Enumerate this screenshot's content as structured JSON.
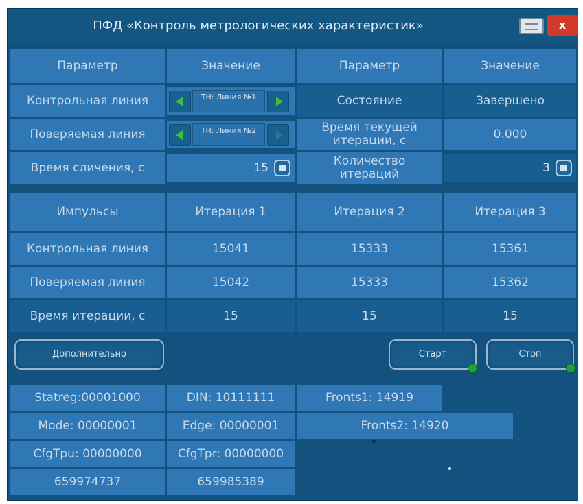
{
  "window": {
    "title": "ПФД «Контроль метрологических характеристик»",
    "close_label": "x"
  },
  "params": {
    "header_param": "Параметр",
    "header_value": "Значение",
    "control_line_label": "Контрольная линия",
    "control_line_value": "ТН: Линия №1",
    "tested_line_label": "Поверяемая линия",
    "tested_line_value": "ТН: Линия №2",
    "compare_time_label": "Время сличения, с",
    "compare_time_value": "15",
    "state_label": "Состояние",
    "state_value": "Завершено",
    "iter_time_label": "Время текущей итерации, с",
    "iter_time_value": "0.000",
    "iter_count_label": "Количество итераций",
    "iter_count_value": "3"
  },
  "pulses": {
    "headers": [
      "Импульсы",
      "Итерация 1",
      "Итерация 2",
      "Итерация 3"
    ],
    "rows": [
      {
        "label": "Контрольная линия",
        "values": [
          "15041",
          "15333",
          "15361"
        ]
      },
      {
        "label": "Поверяемая линия",
        "values": [
          "15042",
          "15333",
          "15362"
        ]
      },
      {
        "label": "Время итерации, с",
        "values": [
          "15",
          "15",
          "15"
        ]
      }
    ]
  },
  "buttons": {
    "more": "Дополнительно",
    "start": "Старт",
    "stop": "Стоп"
  },
  "debug": {
    "statreg": "Statreg:00001000",
    "din": "DIN:   10111111",
    "fronts1": "Fronts1: 14919",
    "mode": "Mode:  00000001",
    "edge": "Edge:  00000001",
    "fronts2": "Fronts2: 14920",
    "cfgtpu": "CfgTpu:  00000000",
    "cfgtpr": "CfgTpr:  00000000",
    "counter1": "659974737",
    "counter2": "659985389"
  },
  "colors": {
    "window_bg": "#13527f",
    "cell": "#2f78b5",
    "cell_dark": "#185e90",
    "text": "#c6d8ea",
    "led": "#1fa23a",
    "close": "#cf3a2b"
  },
  "icons": [
    "arrow-left-icon",
    "arrow-right-icon",
    "keyboard-icon",
    "status-led-icon"
  ]
}
